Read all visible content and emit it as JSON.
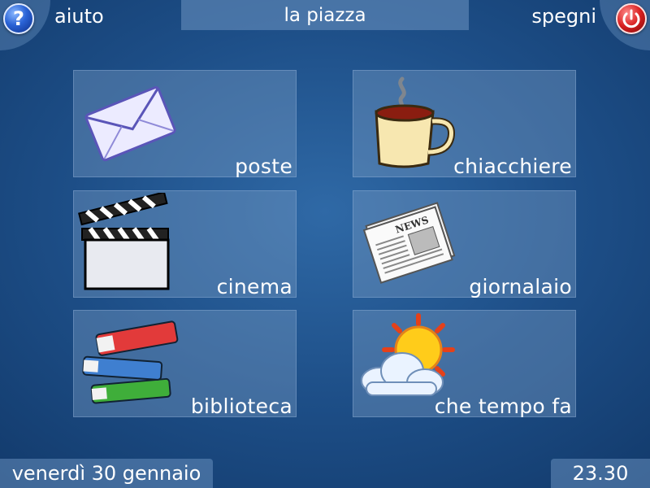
{
  "header": {
    "help_label": "aiuto",
    "title": "la piazza",
    "power_label": "spegni"
  },
  "tiles": [
    {
      "label": "poste",
      "icon": "envelope-icon"
    },
    {
      "label": "chiacchiere",
      "icon": "coffee-cup-icon"
    },
    {
      "label": "cinema",
      "icon": "clapperboard-icon"
    },
    {
      "label": "giornalaio",
      "icon": "newspaper-icon"
    },
    {
      "label": "biblioteca",
      "icon": "books-icon"
    },
    {
      "label": "che tempo fa",
      "icon": "weather-icon"
    }
  ],
  "footer": {
    "date": "venerdì 30 gennaio",
    "time": "23.30"
  },
  "colors": {
    "background": "#1d4e87",
    "help_button": "#2a63d6",
    "power_button": "#d82020"
  }
}
